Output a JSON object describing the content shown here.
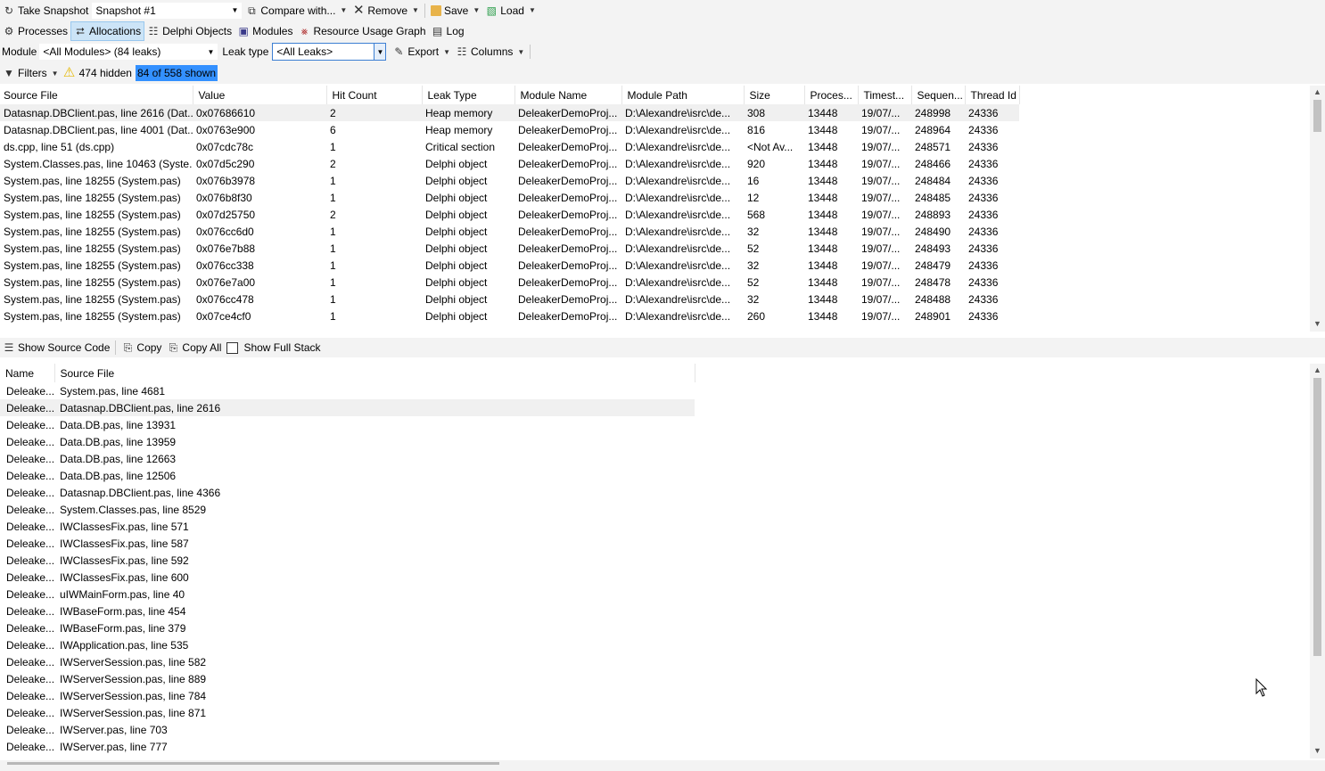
{
  "toolbar1": {
    "take_snapshot": "Take Snapshot",
    "snapshot_selected": "Snapshot #1",
    "compare_with": "Compare with...",
    "remove": "Remove",
    "save": "Save",
    "load": "Load"
  },
  "tabs": [
    {
      "label": "Processes",
      "icon": "processes-icon"
    },
    {
      "label": "Allocations",
      "icon": "allocations-icon",
      "selected": true
    },
    {
      "label": "Delphi Objects",
      "icon": "delphi-objects-icon"
    },
    {
      "label": "Modules",
      "icon": "modules-icon"
    },
    {
      "label": "Resource Usage Graph",
      "icon": "graph-icon"
    },
    {
      "label": "Log",
      "icon": "log-icon"
    }
  ],
  "filterbar": {
    "module_label": "Module",
    "module_value": "<All Modules> (84 leaks)",
    "leak_type_label": "Leak type",
    "leak_type_value": "<All Leaks>",
    "export": "Export",
    "columns": "Columns"
  },
  "statusbar": {
    "filters": "Filters",
    "hidden": "474 hidden",
    "shown": "84 of 558 shown"
  },
  "leaks_table": {
    "columns": [
      "Source File",
      "Value",
      "Hit Count",
      "Leak Type",
      "Module Name",
      "Module Path",
      "Size",
      "Proces...",
      "Timest...",
      "Sequen...",
      "Thread Id"
    ],
    "rows": [
      [
        "Datasnap.DBClient.pas, line 2616 (Dat...",
        "0x07686610",
        "2",
        "Heap memory",
        "DeleakerDemoProj...",
        "D:\\Alexandre\\isrc\\de...",
        "308",
        "13448",
        "19/07/...",
        "248998",
        "24336"
      ],
      [
        "Datasnap.DBClient.pas, line 4001 (Dat...",
        "0x0763e900",
        "6",
        "Heap memory",
        "DeleakerDemoProj...",
        "D:\\Alexandre\\isrc\\de...",
        "816",
        "13448",
        "19/07/...",
        "248964",
        "24336"
      ],
      [
        "ds.cpp, line 51 (ds.cpp)",
        "0x07cdc78c",
        "1",
        "Critical section",
        "DeleakerDemoProj...",
        "D:\\Alexandre\\isrc\\de...",
        "<Not Av...",
        "13448",
        "19/07/...",
        "248571",
        "24336"
      ],
      [
        "System.Classes.pas, line 10463 (Syste...",
        "0x07d5c290",
        "2",
        "Delphi object",
        "DeleakerDemoProj...",
        "D:\\Alexandre\\isrc\\de...",
        "920",
        "13448",
        "19/07/...",
        "248466",
        "24336"
      ],
      [
        "System.pas, line 18255 (System.pas)",
        "0x076b3978",
        "1",
        "Delphi object",
        "DeleakerDemoProj...",
        "D:\\Alexandre\\isrc\\de...",
        "16",
        "13448",
        "19/07/...",
        "248484",
        "24336"
      ],
      [
        "System.pas, line 18255 (System.pas)",
        "0x076b8f30",
        "1",
        "Delphi object",
        "DeleakerDemoProj...",
        "D:\\Alexandre\\isrc\\de...",
        "12",
        "13448",
        "19/07/...",
        "248485",
        "24336"
      ],
      [
        "System.pas, line 18255 (System.pas)",
        "0x07d25750",
        "2",
        "Delphi object",
        "DeleakerDemoProj...",
        "D:\\Alexandre\\isrc\\de...",
        "568",
        "13448",
        "19/07/...",
        "248893",
        "24336"
      ],
      [
        "System.pas, line 18255 (System.pas)",
        "0x076cc6d0",
        "1",
        "Delphi object",
        "DeleakerDemoProj...",
        "D:\\Alexandre\\isrc\\de...",
        "32",
        "13448",
        "19/07/...",
        "248490",
        "24336"
      ],
      [
        "System.pas, line 18255 (System.pas)",
        "0x076e7b88",
        "1",
        "Delphi object",
        "DeleakerDemoProj...",
        "D:\\Alexandre\\isrc\\de...",
        "52",
        "13448",
        "19/07/...",
        "248493",
        "24336"
      ],
      [
        "System.pas, line 18255 (System.pas)",
        "0x076cc338",
        "1",
        "Delphi object",
        "DeleakerDemoProj...",
        "D:\\Alexandre\\isrc\\de...",
        "32",
        "13448",
        "19/07/...",
        "248479",
        "24336"
      ],
      [
        "System.pas, line 18255 (System.pas)",
        "0x076e7a00",
        "1",
        "Delphi object",
        "DeleakerDemoProj...",
        "D:\\Alexandre\\isrc\\de...",
        "52",
        "13448",
        "19/07/...",
        "248478",
        "24336"
      ],
      [
        "System.pas, line 18255 (System.pas)",
        "0x076cc478",
        "1",
        "Delphi object",
        "DeleakerDemoProj...",
        "D:\\Alexandre\\isrc\\de...",
        "32",
        "13448",
        "19/07/...",
        "248488",
        "24336"
      ],
      [
        "System.pas, line 18255 (System.pas)",
        "0x07ce4cf0",
        "1",
        "Delphi object",
        "DeleakerDemoProj...",
        "D:\\Alexandre\\isrc\\de...",
        "260",
        "13448",
        "19/07/...",
        "248901",
        "24336"
      ]
    ]
  },
  "stack_toolbar": {
    "show_source": "Show Source Code",
    "copy": "Copy",
    "copy_all": "Copy All",
    "show_full_stack": "Show Full Stack"
  },
  "stack_table": {
    "columns": [
      "Name",
      "Source File"
    ],
    "rows": [
      [
        "Deleake...",
        "System.pas, line 4681"
      ],
      [
        "Deleake...",
        "Datasnap.DBClient.pas, line 2616"
      ],
      [
        "Deleake...",
        "Data.DB.pas, line 13931"
      ],
      [
        "Deleake...",
        "Data.DB.pas, line 13959"
      ],
      [
        "Deleake...",
        "Data.DB.pas, line 12663"
      ],
      [
        "Deleake...",
        "Data.DB.pas, line 12506"
      ],
      [
        "Deleake...",
        "Datasnap.DBClient.pas, line 4366"
      ],
      [
        "Deleake...",
        "System.Classes.pas, line 8529"
      ],
      [
        "Deleake...",
        "IWClassesFix.pas, line 571"
      ],
      [
        "Deleake...",
        "IWClassesFix.pas, line 587"
      ],
      [
        "Deleake...",
        "IWClassesFix.pas, line 592"
      ],
      [
        "Deleake...",
        "IWClassesFix.pas, line 600"
      ],
      [
        "Deleake...",
        "uIWMainForm.pas, line 40"
      ],
      [
        "Deleake...",
        "IWBaseForm.pas, line 454"
      ],
      [
        "Deleake...",
        "IWBaseForm.pas, line 379"
      ],
      [
        "Deleake...",
        "IWApplication.pas, line 535"
      ],
      [
        "Deleake...",
        "IWServerSession.pas, line 582"
      ],
      [
        "Deleake...",
        "IWServerSession.pas, line 889"
      ],
      [
        "Deleake...",
        "IWServerSession.pas, line 784"
      ],
      [
        "Deleake...",
        "IWServerSession.pas, line 871"
      ],
      [
        "Deleake...",
        "IWServer.pas, line 703"
      ],
      [
        "Deleake...",
        "IWServer.pas, line 777"
      ]
    ]
  }
}
